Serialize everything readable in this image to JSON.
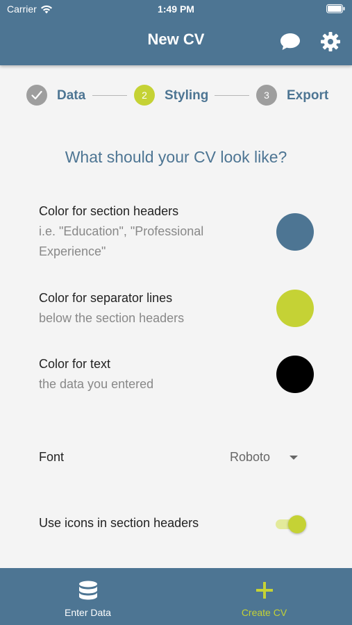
{
  "status_bar": {
    "carrier": "Carrier",
    "time": "1:49 PM"
  },
  "app_bar": {
    "title": "New CV",
    "icons": [
      "chat-icon",
      "gear-icon"
    ]
  },
  "stepper": {
    "steps": [
      {
        "number": "",
        "label": "Data",
        "state": "completed"
      },
      {
        "number": "2",
        "label": "Styling",
        "state": "active"
      },
      {
        "number": "3",
        "label": "Export",
        "state": "inactive"
      }
    ]
  },
  "main": {
    "question": "What should your CV look like?",
    "color_options": [
      {
        "title": "Color for section headers",
        "subtitle": "i.e. \"Education\", \"Professional Experience\"",
        "color": "#4d7593"
      },
      {
        "title": "Color for separator lines",
        "subtitle": "below the section headers",
        "color": "#c5d235"
      },
      {
        "title": "Color for text",
        "subtitle": "the data you entered",
        "color": "#000000"
      }
    ],
    "font": {
      "label": "Font",
      "value": "Roboto"
    },
    "icons_toggle": {
      "label": "Use icons in section headers",
      "enabled": true
    }
  },
  "bottom_nav": {
    "tabs": [
      {
        "label": "Enter Data",
        "icon": "database-icon",
        "active": false
      },
      {
        "label": "Create CV",
        "icon": "plus-icon",
        "active": true
      }
    ]
  },
  "colors": {
    "primary": "#4d7593",
    "accent": "#c5d235",
    "inactive_step": "#9e9e9e"
  }
}
